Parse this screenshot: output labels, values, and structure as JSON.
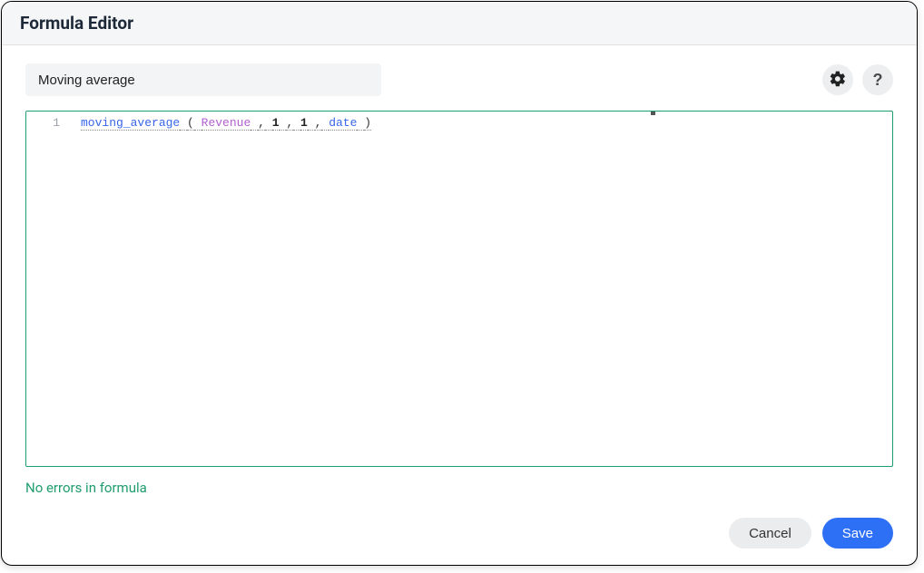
{
  "header": {
    "title": "Formula Editor"
  },
  "name_input": {
    "value": "Moving average"
  },
  "editor": {
    "line_number": "1",
    "tokens": {
      "fn": "moving_average",
      "open": "(",
      "field": "Revenue",
      "sep1": ",",
      "arg1": "1",
      "sep2": ",",
      "arg2": "1",
      "sep3": ",",
      "kw": "date",
      "close": ")"
    }
  },
  "status": {
    "message": "No errors in formula"
  },
  "footer": {
    "cancel": "Cancel",
    "save": "Save"
  }
}
